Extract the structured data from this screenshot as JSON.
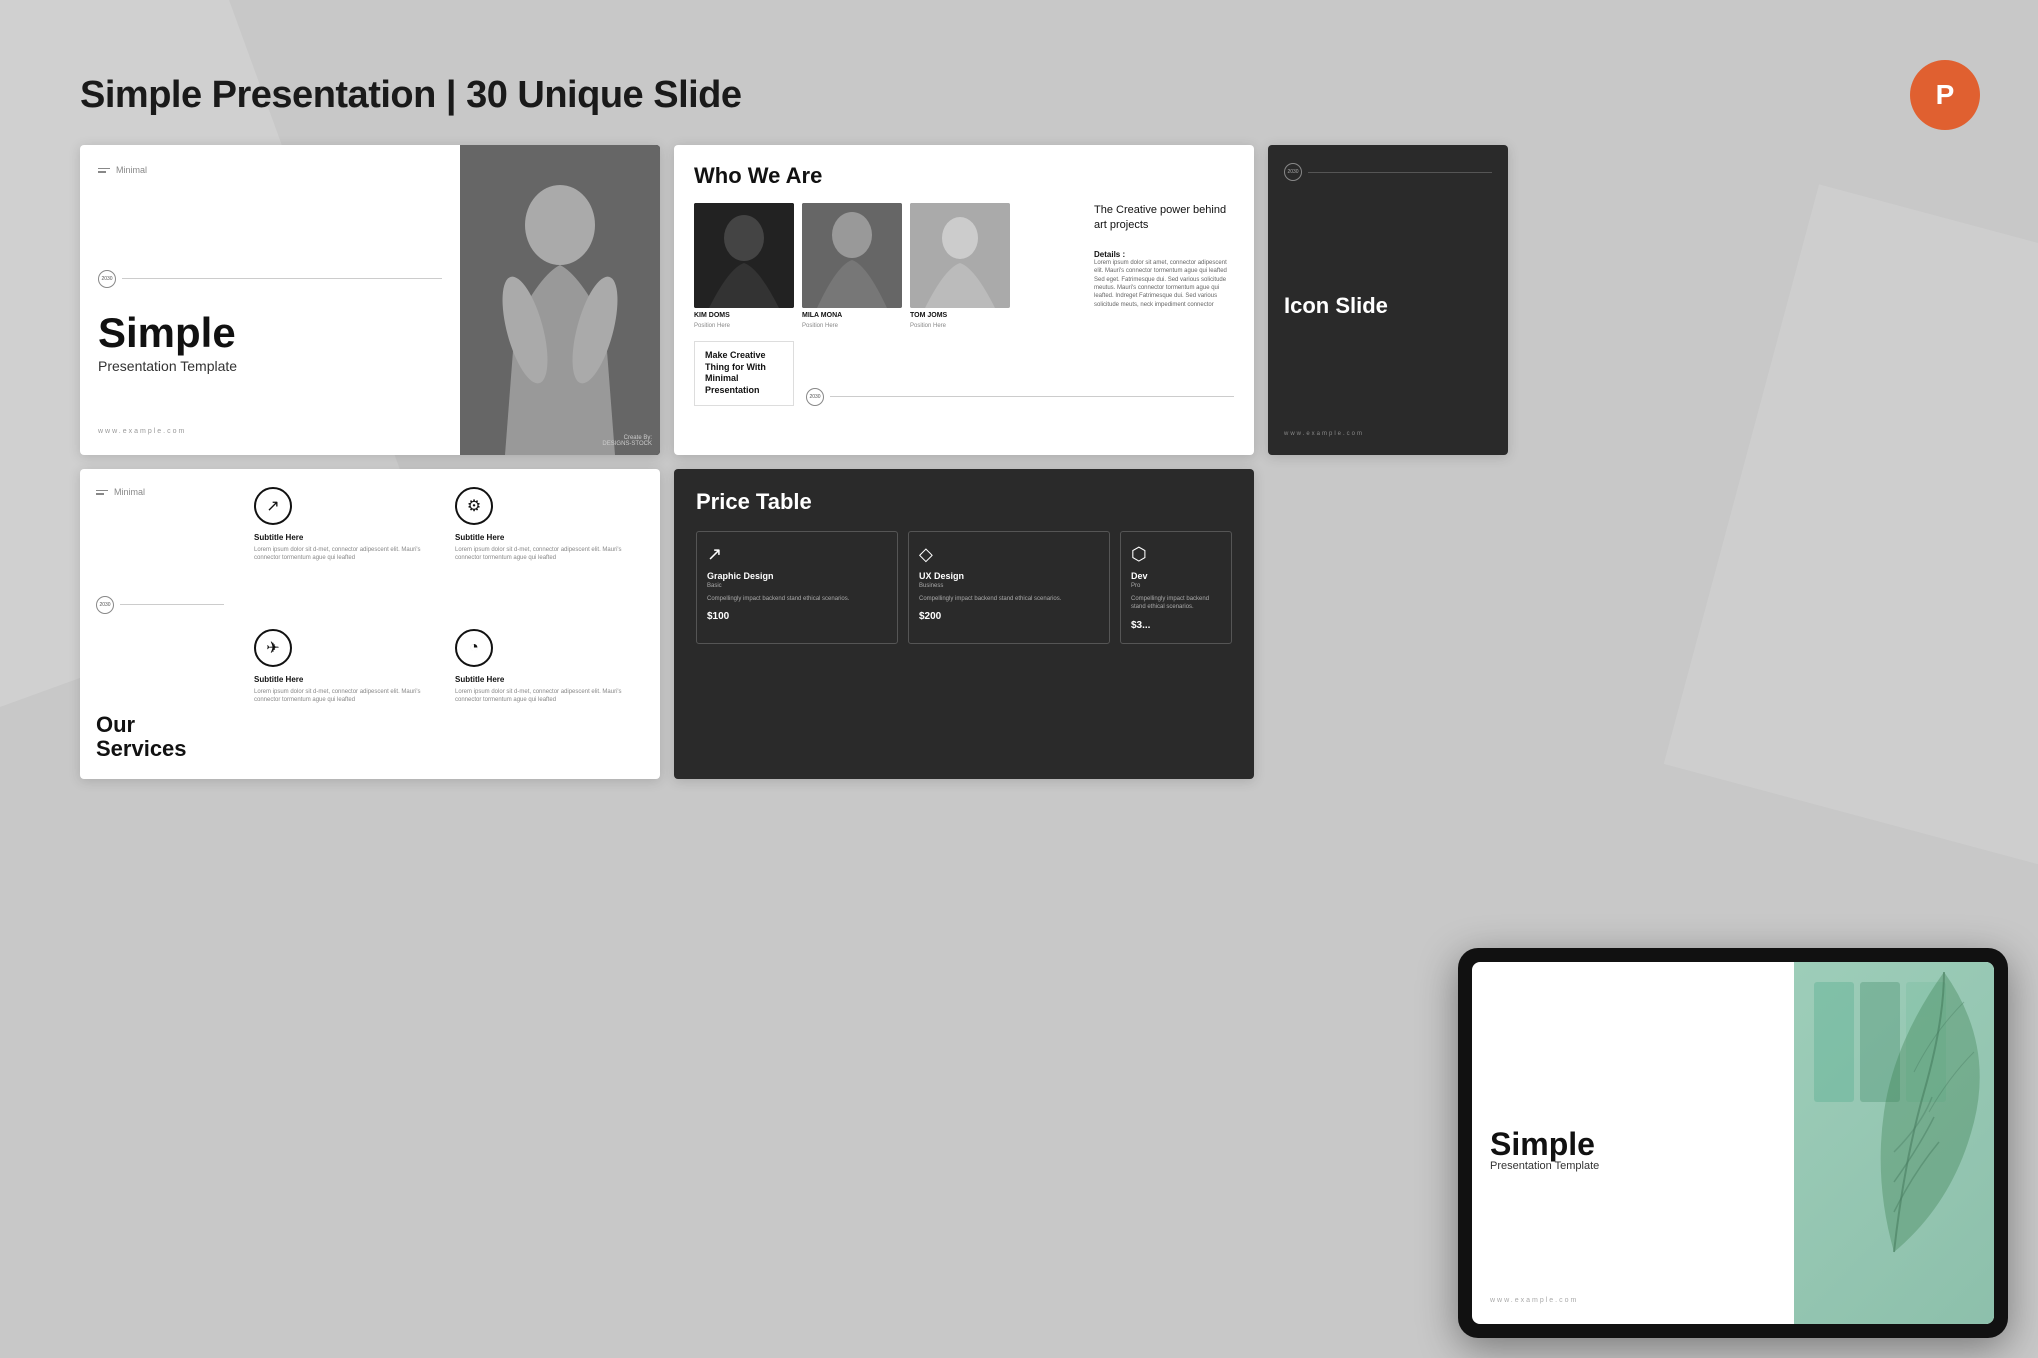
{
  "page": {
    "background": "#c8c8c8"
  },
  "header": {
    "title": "Simple Presentation | 30 Unique Slide",
    "pptx_icon": "P"
  },
  "slide1": {
    "logo_text": "Minimal",
    "year": "2030",
    "main_title": "Simple",
    "subtitle": "Presentation Template",
    "url": "www.example.com",
    "credit_label": "Create By:",
    "credit_name": "DESIGNS-STOCK"
  },
  "slide2": {
    "title": "Who We Are",
    "tagline": "The Creative power behind art projects",
    "details_title": "Details :",
    "details_text": "Lorem ipsum dolor sit amet, connector adipescent elit. Mauri's connector tormentum ague qui leafted Sed eget. Fatrimesque dui. Sed various solicitude meutus. Mauri's connector tormentum ague qui leafted. Indreget Fatrimesque dui. Sed various solicitude meuts, neck impediment connector",
    "persons": [
      {
        "name": "KIM DOMS",
        "position": "Position Here"
      },
      {
        "name": "MILA MONA",
        "position": "Position Here"
      },
      {
        "name": "TOM JOMS",
        "position": "Position Here"
      }
    ],
    "cta_text": "Make Creative Thing for With Minimal Presentation",
    "year": "2030"
  },
  "slide3": {
    "year": "2030",
    "title": "Icon Slide",
    "url": "www.example.com"
  },
  "slide4": {
    "logo_text": "Minimal",
    "year": "2030",
    "title": "Our Services",
    "services": [
      {
        "icon": "↗",
        "title": "Subtitle Here",
        "text": "Lorem ipsum dolor sit d-met, connector adipescent elit. Mauri's connector tormentum ague qui leafted"
      },
      {
        "icon": "⚙",
        "title": "Subtitle Here",
        "text": "Lorem ipsum dolor sit d-met, connector adipescent elit. Mauri's connector tormentum ague qui leafted"
      },
      {
        "icon": "✈",
        "title": "Subtitle Here",
        "text": "Lorem ipsum dolor sit d-met, connector adipescent elit. Mauri's connector tormentum ague qui leafted"
      },
      {
        "icon": "◔",
        "title": "Subtitle Here",
        "text": "Lorem ipsum dolor sit d-met, connector adipescent elit. Mauri's connector tormentum ague qui leafted"
      }
    ]
  },
  "slide5": {
    "title": "Price Table",
    "cards": [
      {
        "icon": "↗",
        "title": "Graphic Design",
        "plan": "Basic",
        "desc": "Compellingly impact backend stand ethical scenarios.",
        "price": "$100"
      },
      {
        "icon": "◇",
        "title": "UX Design",
        "plan": "Business",
        "desc": "Compellingly impact backend stand ethical scenarios.",
        "price": "$200"
      },
      {
        "icon": "⬡",
        "title": "Dev",
        "plan": "Pro",
        "desc": "Compellingly impact backend stand ethical scenarios.",
        "price": "$3..."
      }
    ]
  },
  "tablet_slide": {
    "main_title": "Simple",
    "subtitle": "Presentation Template",
    "url": "www.example.com"
  }
}
